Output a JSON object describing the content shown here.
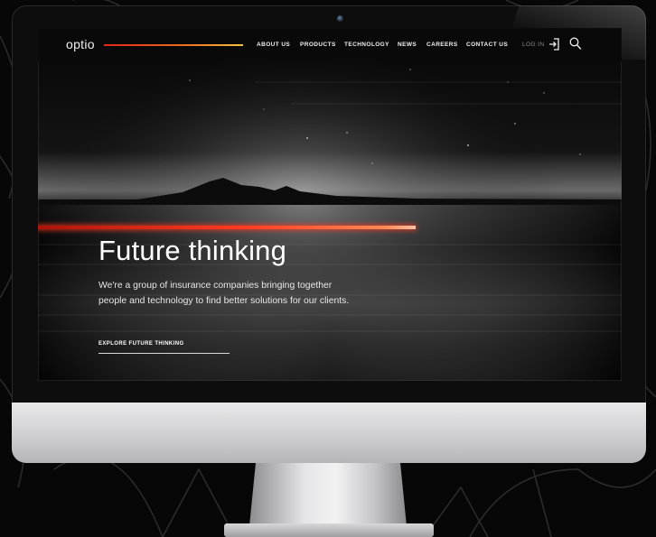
{
  "brand": {
    "name": "optio"
  },
  "nav": {
    "items": [
      "ABOUT US",
      "PRODUCTS",
      "TECHNOLOGY",
      "NEWS",
      "CAREERS",
      "CONTACT US"
    ],
    "login_label": "LOG IN",
    "login_icon": "login-icon",
    "search_icon": "search-icon"
  },
  "hero": {
    "headline": "Future thinking",
    "intro": "We're a group of insurance companies bringing together people and technology to find better solutions for our clients.",
    "cta": "EXPLORE FUTURE THINKING"
  },
  "colors": {
    "accent_red": "#ff3b22",
    "accent_orange": "#ee6a1f",
    "accent_yellow": "#f6c03e"
  }
}
